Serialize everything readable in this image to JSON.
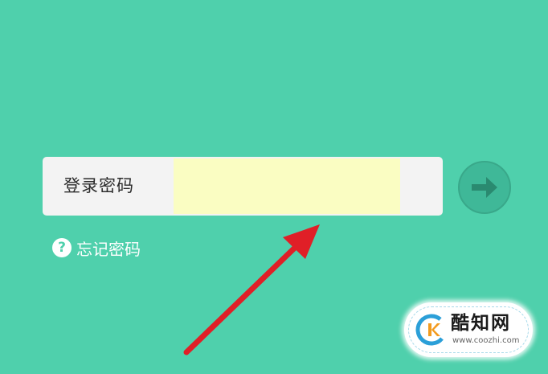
{
  "login": {
    "password_label": "登录密码",
    "password_value": ""
  },
  "forgot": {
    "icon_glyph": "?",
    "label": "忘记密码"
  },
  "submit": {
    "icon": "arrow-right-icon"
  },
  "watermark": {
    "name": "酷知网",
    "url": "www.coozhi.com"
  },
  "colors": {
    "background": "#4fd0ac",
    "input_box": "#f3f3f3",
    "input_field": "#fafdc2",
    "submit_button": "#3fb898",
    "annotation_arrow": "#e01f27"
  }
}
